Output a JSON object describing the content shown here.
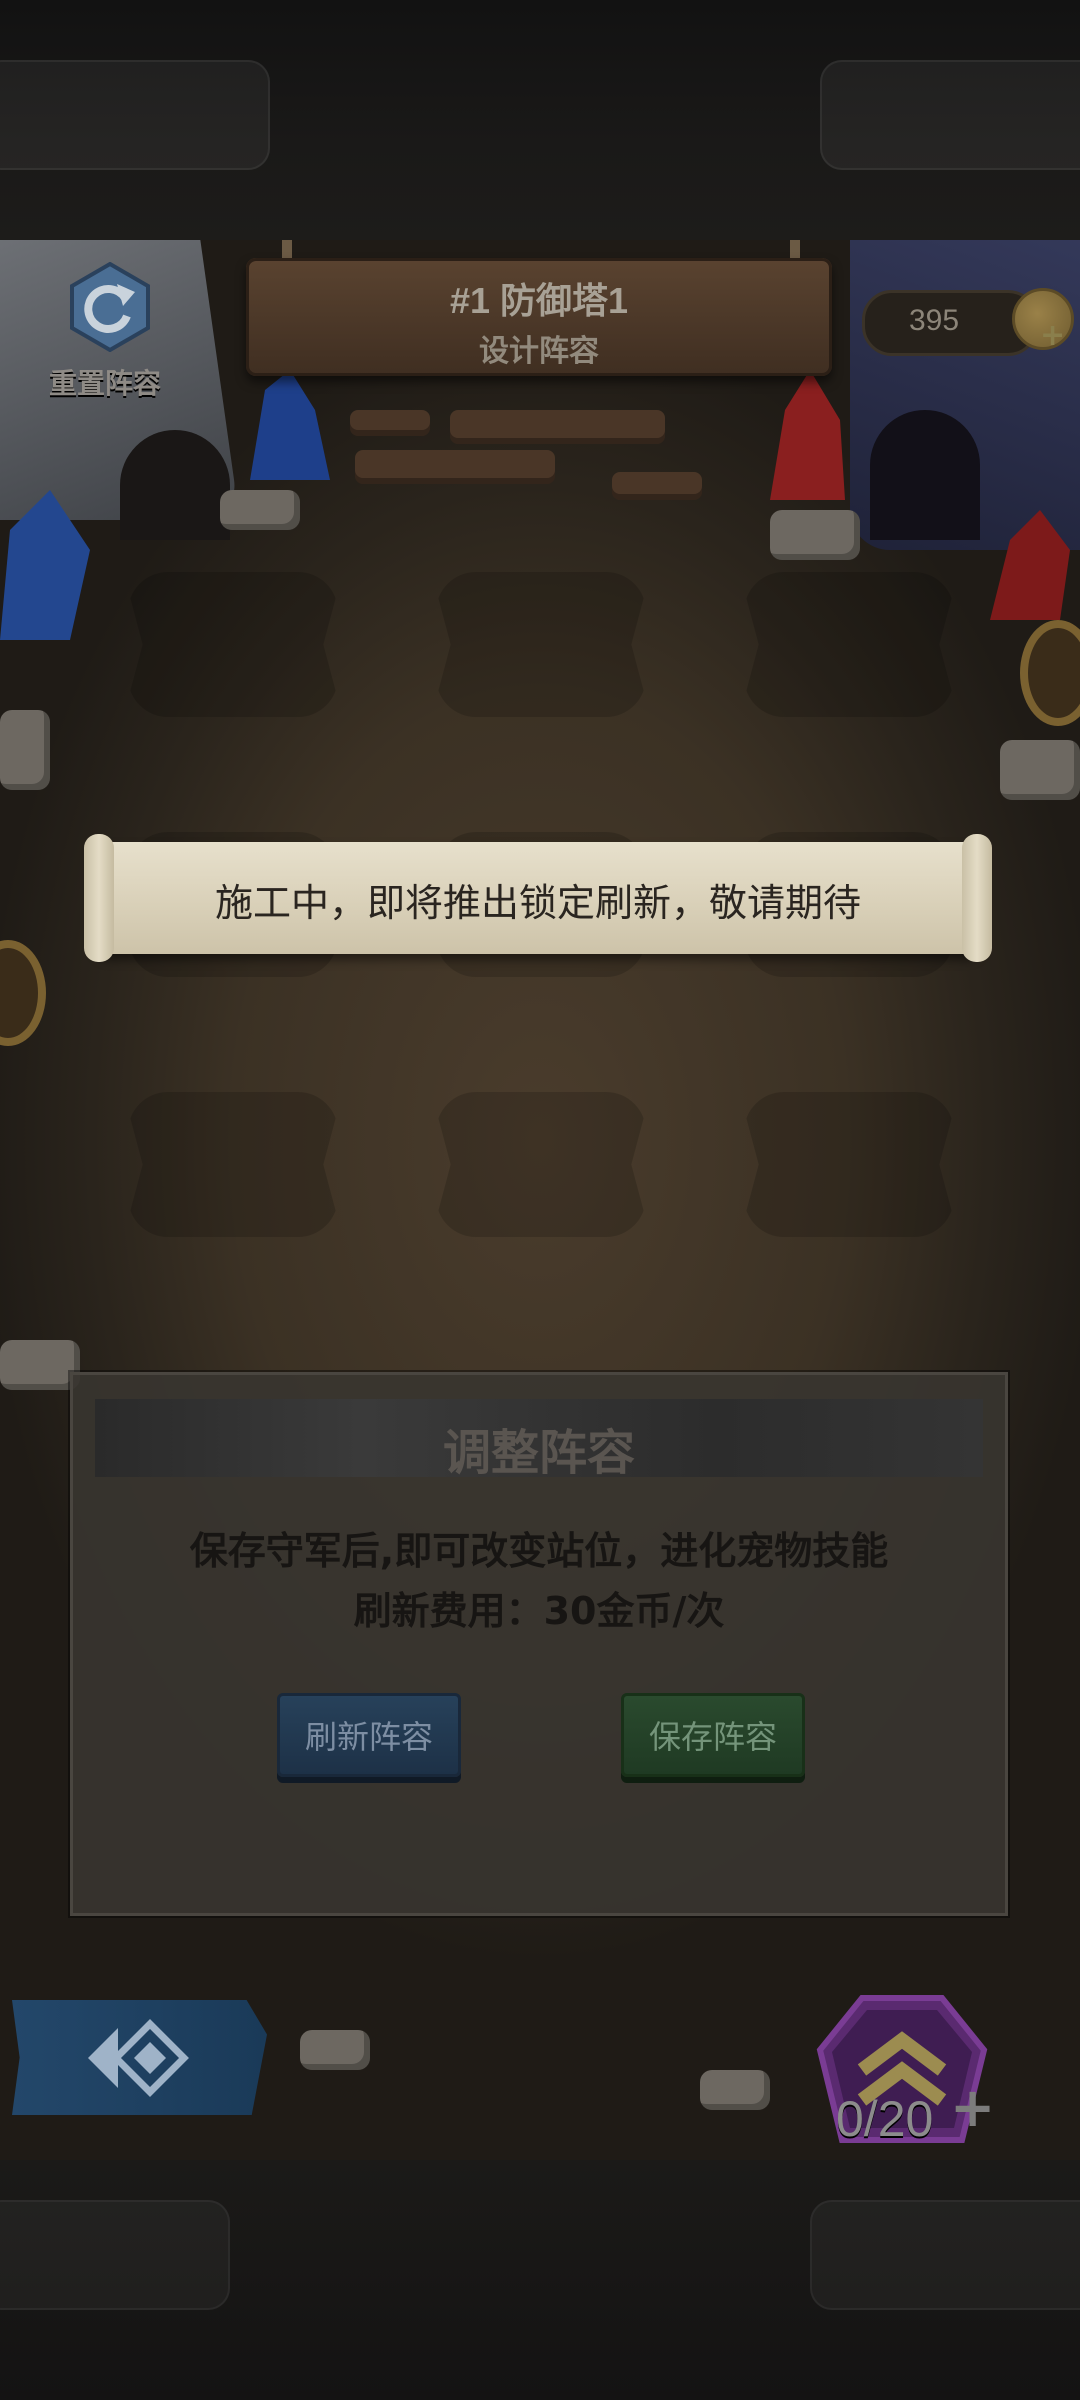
{
  "header": {
    "title": "#1 防御塔1",
    "subtitle": "设计阵容"
  },
  "reset_button": {
    "label": "重置阵容",
    "icon": "refresh-icon"
  },
  "currency": {
    "value": "395",
    "icon": "gold-coin-icon"
  },
  "notice": {
    "text": "施工中，即将推出锁定刷新，敬请期待"
  },
  "panel": {
    "title": "调整阵容",
    "line1": "保存守军后,即可改变站位，进化宠物技能",
    "line2": "刷新费用：30金币/次",
    "refresh_label": "刷新阵容",
    "save_label": "保存阵容"
  },
  "bottom": {
    "count": "0/20",
    "back_icon": "back-arrow-icon",
    "upgrade_icon": "rank-chevron-icon"
  },
  "colors": {
    "refresh_button": "#1d3147",
    "save_button": "#1f3a23",
    "scroll": "#e7e0cc"
  }
}
